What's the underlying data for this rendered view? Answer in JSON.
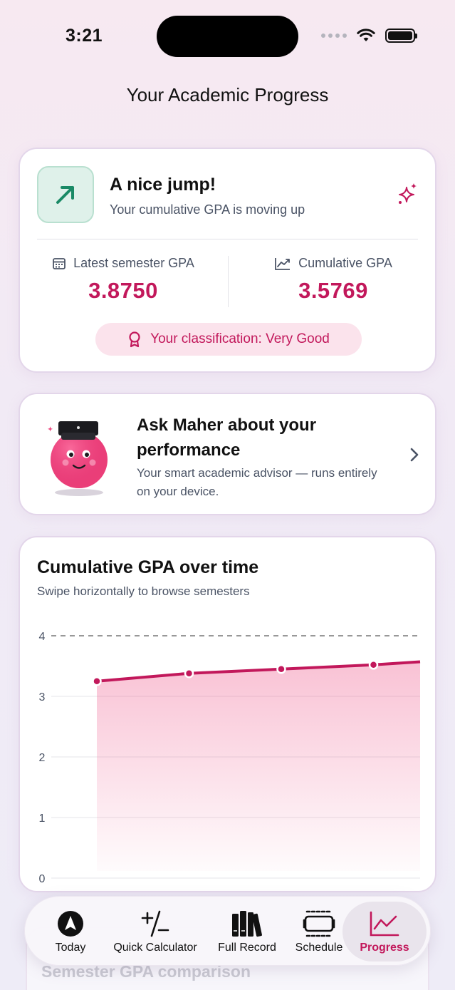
{
  "status_bar": {
    "time": "3:21"
  },
  "page_title": "Your Academic Progress",
  "progress_card": {
    "headline": "A nice jump!",
    "subtitle": "Your cumulative GPA is moving up",
    "latest_label": "Latest semester GPA",
    "latest_value": "3.8750",
    "cumulative_label": "Cumulative GPA",
    "cumulative_value": "3.5769",
    "classification": "Your classification: Very Good",
    "icons": {
      "trend": "trend-up-icon",
      "sparkle": "sparkle-icon",
      "calendar": "calendar-icon",
      "chart": "line-chart-icon",
      "award": "award-ribbon-icon"
    },
    "colors": {
      "accent": "#c2185b",
      "trend_green": "#1a8a66"
    }
  },
  "maher_card": {
    "title": "Ask Maher about your performance",
    "subtitle": "Your smart academic advisor — runs entirely on your device."
  },
  "chart_card": {
    "title": "Cumulative GPA over time",
    "subtitle": "Swipe horizontally to browse semesters"
  },
  "chart_data": {
    "type": "area",
    "title": "Cumulative GPA over time",
    "xlabel": "",
    "ylabel": "",
    "ylim": [
      0,
      4
    ],
    "y_ticks": [
      "0",
      "1",
      "2",
      "3",
      "4"
    ],
    "reference_line": 4,
    "grid": true,
    "series": [
      {
        "values": [
          3.25,
          3.38,
          3.45,
          3.52,
          3.57
        ]
      }
    ],
    "color": "#c2185b"
  },
  "ghost_card": {
    "title": "Semester GPA comparison"
  },
  "tabbar": {
    "items": [
      {
        "label": "Today",
        "icon": "compass-icon"
      },
      {
        "label": "Quick Calculator",
        "icon": "plus-minus-icon"
      },
      {
        "label": "Full Record",
        "icon": "books-icon"
      },
      {
        "label": "Schedule",
        "icon": "schedule-icon"
      },
      {
        "label": "Progress",
        "icon": "progress-chart-icon",
        "selected": true
      }
    ]
  }
}
